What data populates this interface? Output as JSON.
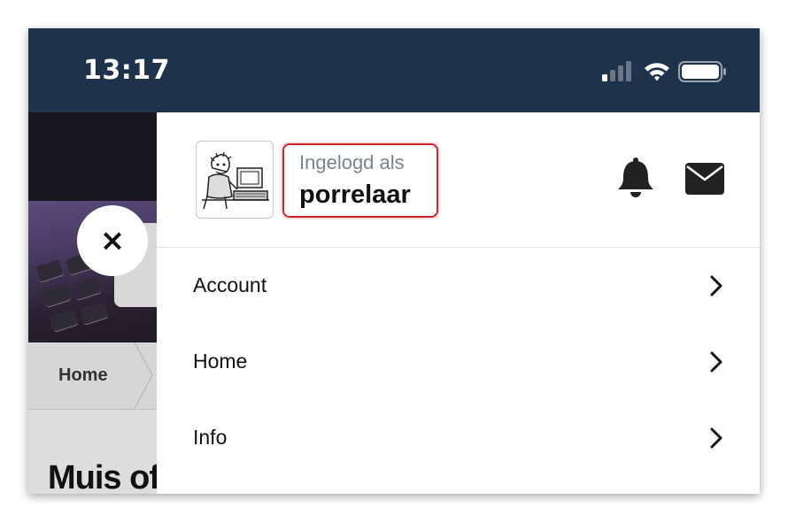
{
  "status_bar": {
    "time": "13:17",
    "icons": [
      "signal-icon",
      "wifi-icon",
      "battery-icon"
    ]
  },
  "background_page": {
    "close_icon": "×",
    "breadcrumb": [
      "Home"
    ],
    "title": "Muis of"
  },
  "panel": {
    "logged_in_label": "Ingelogd als",
    "username": "porrelaar",
    "avatar": "avatar-icon",
    "header_icons": [
      "bell-icon",
      "mail-icon"
    ],
    "menu": [
      {
        "label": "Account"
      },
      {
        "label": "Home"
      },
      {
        "label": "Info"
      }
    ]
  },
  "colors": {
    "status_bar_bg": "#1f324b",
    "highlight_border": "#d9202b",
    "muted_text": "#7a8391"
  }
}
